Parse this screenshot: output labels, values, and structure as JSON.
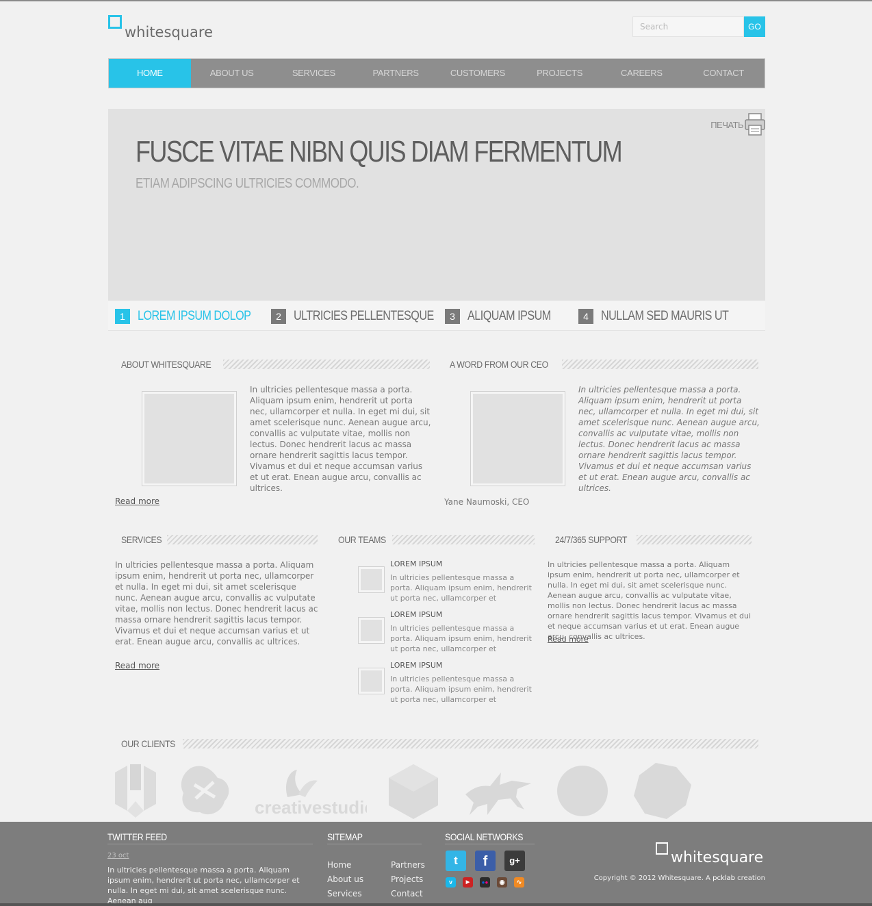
{
  "header": {
    "logo_text": "whitesquare",
    "search_placeholder": "Search",
    "search_button": "GO"
  },
  "nav": [
    "HOME",
    "ABOUT US",
    "SERVICES",
    "PARTNERS",
    "CUSTOMERS",
    "PROJECTS",
    "CAREERS",
    "CONTACT"
  ],
  "slider": {
    "print_label": "ПЕЧАТЬ",
    "title": "FUSCE VITAE NIBN QUIS DIAM FERMENTUM",
    "subtitle": "ETIAM ADIPSCING ULTRICIES COMMODO.",
    "tabs": [
      {
        "num": "1",
        "label": "LOREM IPSUM DOLOP"
      },
      {
        "num": "2",
        "label": "ULTRICIES PELLENTESQUE"
      },
      {
        "num": "3",
        "label": "ALIQUAM IPSUM"
      },
      {
        "num": "4",
        "label": "NULLAM SED MAURIS UT"
      }
    ]
  },
  "about": {
    "heading": "ABOUT WHITESQUARE",
    "text": "In ultricies pellentesque massa a porta. Aliquam ipsum enim, hendrerit ut porta nec, ullamcorper et nulla. In eget mi dui, sit amet scelerisque nunc. Aenean augue arcu, convallis ac vulputate vitae, mollis non lectus. Donec hendrerit lacus ac massa ornare hendrerit sagittis lacus tempor. Vivamus et dui et neque accumsan varius et ut erat. Enean augue arcu, convallis ac ultrices.",
    "read_more": "Read more"
  },
  "ceo": {
    "heading": "A WORD FROM OUR CEO",
    "text": "In ultricies pellentesque massa a porta. Aliquam ipsum enim, hendrerit ut porta nec, ullamcorper et nulla. In eget mi dui, sit amet scelerisque nunc. Aenean augue arcu, convallis ac vulputate vitae, mollis non lectus. Donec hendrerit lacus ac massa ornare hendrerit sagittis lacus tempor. Vivamus et dui et neque accumsan varius et ut erat. Enean augue arcu, convallis ac ultrices.",
    "signature": "Yane Naumoski, CEO"
  },
  "services": {
    "heading": "SERVICES",
    "text": "In ultricies pellentesque massa a porta. Aliquam ipsum enim, hendrerit ut porta nec, ullamcorper et nulla. In eget mi dui, sit amet scelerisque nunc. Aenean augue arcu, convallis ac vulputate vitae, mollis non lectus. Donec hendrerit lacus ac massa ornare hendrerit sagittis lacus tempor. Vivamus et dui et neque accumsan varius et ut erat. Enean augue arcu, convallis ac ultrices.",
    "read_more": "Read more"
  },
  "teams": {
    "heading": "OUR TEAMS",
    "items": [
      {
        "title": "LOREM IPSUM",
        "text": "In ultricies pellentesque massa a porta. Aliquam ipsum enim, hendrerit ut porta nec, ullamcorper et"
      },
      {
        "title": "LOREM IPSUM",
        "text": "In ultricies pellentesque massa a porta. Aliquam ipsum enim, hendrerit ut porta nec, ullamcorper et"
      },
      {
        "title": "LOREM IPSUM",
        "text": "In ultricies pellentesque massa a porta. Aliquam ipsum enim, hendrerit ut porta nec, ullamcorper et"
      }
    ]
  },
  "support": {
    "heading": "24/7/365 SUPPORT",
    "text": "In ultricies pellentesque massa a porta. Aliquam ipsum enim, hendrerit ut porta nec, ullamcorper et nulla. In eget mi dui, sit amet scelerisque nunc. Aenean augue arcu, convallis ac vulputate vitae, mollis non lectus. Donec hendrerit lacus ac massa ornare hendrerit sagittis lacus tempor. Vivamus et dui et neque accumsan varius et ut erat. Enean augue arcu, convallis ac ultrices.",
    "read_more": "Read more"
  },
  "clients": {
    "heading": "OUR CLIENTS",
    "logo_text": "creativestudio"
  },
  "footer": {
    "twitter_heading": "TWITTER FEED",
    "tweet_date": "23 oct",
    "tweet_text": "In ultricies pellentesque massa a porta. Aliquam ipsum enim, hendrerit ut porta nec, ullamcorper et nulla. In eget mi dui, sit amet scelerisque nunc. Aenean aug",
    "sitemap_heading": "SITEMAP",
    "sitemap": [
      "Home",
      "About us",
      "Services",
      "Partners",
      "Projects",
      "Contact"
    ],
    "social_heading": "SOCIAL NETWORKS",
    "social_icons": [
      "twitter-icon",
      "facebook-icon",
      "google-plus-icon",
      "vimeo-icon",
      "youtube-icon",
      "flickr-icon",
      "instagram-icon",
      "rss-icon"
    ],
    "logo_text": "whitesquare",
    "copyright_prefix": "Copyright © 2012 Whitesquare. A",
    "copyright_link": "pcklab",
    "copyright_suffix": "creation"
  },
  "colors": {
    "accent": "#28c3e8",
    "nav_bg": "#8e8e8e",
    "footer_bg": "#7d7d7d"
  }
}
